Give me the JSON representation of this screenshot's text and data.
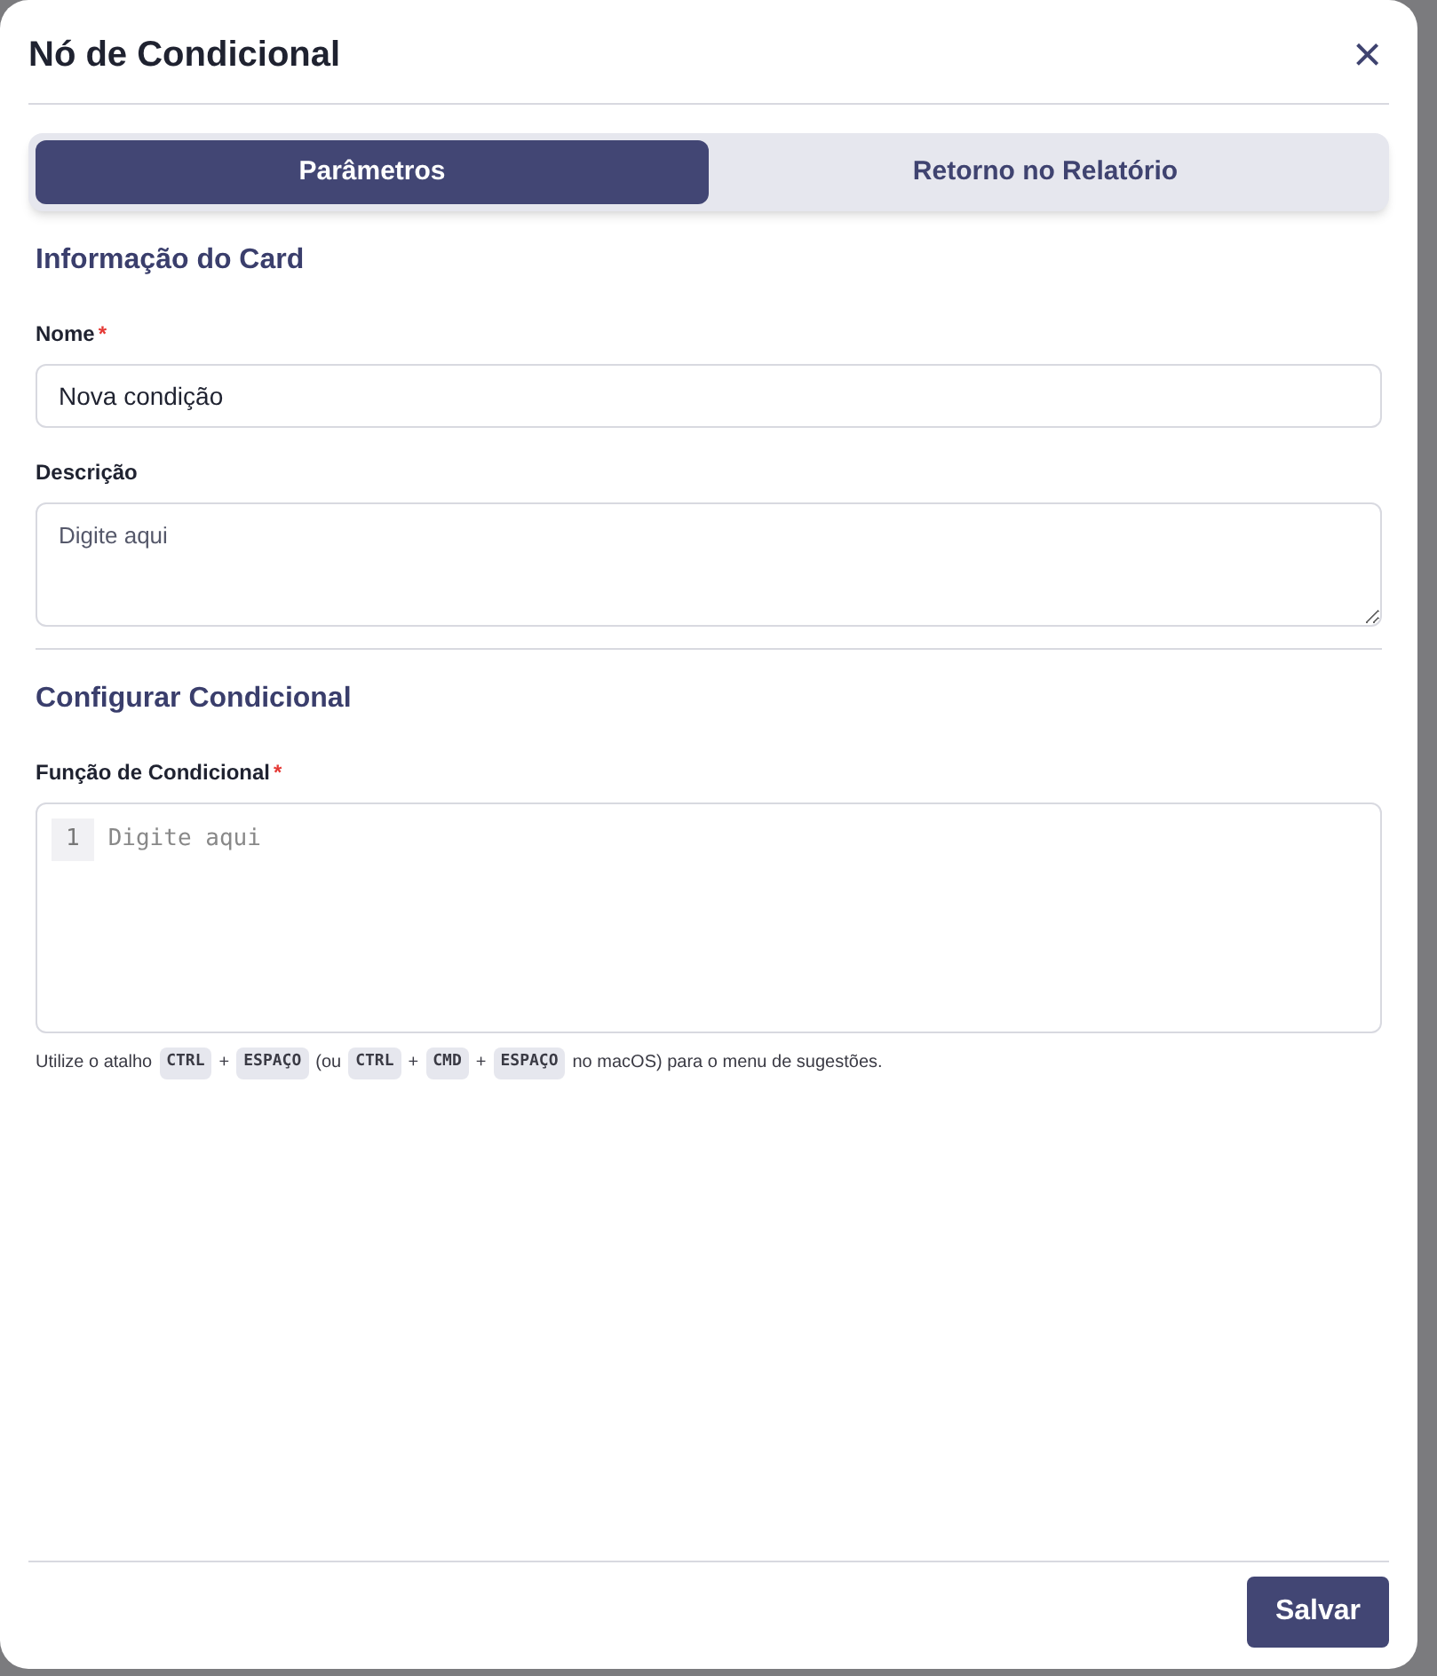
{
  "dialog": {
    "title": "Nó de Condicional",
    "close": "×"
  },
  "tabs": [
    {
      "label": "Parâmetros",
      "selected": true
    },
    {
      "label": "Retorno no Relatório",
      "selected": false
    }
  ],
  "section_1": {
    "heading": "Informação do Card"
  },
  "name_field": {
    "label": "Nome",
    "required_mark": "*",
    "value": "Nova condição"
  },
  "description_field": {
    "label": "Descrição",
    "placeholder": "Digite aqui"
  },
  "section_2": {
    "heading": "Configurar Condicional"
  },
  "code_field": {
    "label": "Função de Condicional",
    "required_mark": "*",
    "line_number": "1",
    "placeholder": "Digite aqui"
  },
  "hint": [
    {
      "kind": "text",
      "text": "Utilize o atalho"
    },
    {
      "kind": "key",
      "text": "CTRL"
    },
    {
      "kind": "text",
      "text": "+"
    },
    {
      "kind": "key",
      "text": "ESPAÇO"
    },
    {
      "kind": "text",
      "text": "(ou"
    },
    {
      "kind": "key",
      "text": "CTRL"
    },
    {
      "kind": "text",
      "text": "+"
    },
    {
      "kind": "key",
      "text": "CMD"
    },
    {
      "kind": "text",
      "text": "+"
    },
    {
      "kind": "key",
      "text": "ESPAÇO"
    },
    {
      "kind": "text",
      "text": "no macOS) para o menu de sugestões."
    }
  ],
  "footer": {
    "save": "Salvar"
  }
}
